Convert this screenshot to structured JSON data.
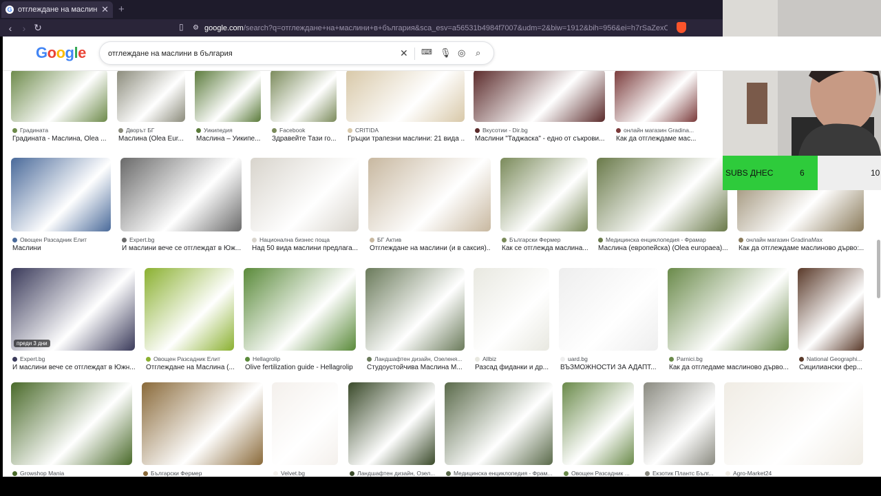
{
  "browser": {
    "tab_title": "отглеждане на маслини в българ...",
    "url_domain": "google.com",
    "url_rest": "/search?q=отглеждане+на+маслини+в+българия&sca_esv=a56531b4984f7007&udm=2&biw=1912&bih=956&ei=h7rSaZexOPSOxc8Pxr2_8QI&..."
  },
  "google": {
    "logo": "Google",
    "query": "отглеждане на маслини в българия"
  },
  "rows": [
    [
      {
        "source": "Градината",
        "title": "Градината - Маслина, Olea ...",
        "color": "#6d8a4a"
      },
      {
        "source": "Дворът БГ",
        "title": "Маслина (Olea Eur...",
        "color": "#8a8a7a"
      },
      {
        "source": "Уикипедия",
        "title": "Маслина – Уикипе...",
        "color": "#5a7a3a"
      },
      {
        "source": "Facebook",
        "title": "Здравейте Тази го...",
        "color": "#7a8a5a"
      },
      {
        "source": "CRITIDA",
        "title": "Гръцки трапезни маслини: 21 вида ...",
        "color": "#d8c8a8"
      },
      {
        "source": "Вкусотии - Dir.bg",
        "title": "Маслини \"Таджаска\" - едно от съкрови...",
        "color": "#5a2a2a"
      },
      {
        "source": "онлайн магазин Gradina...",
        "title": "Как да отглеждаме мас...",
        "color": "#7a3a3a"
      }
    ],
    [
      {
        "source": "Овощен Разсадник Елит",
        "title": "Маслини",
        "color": "#4a6a9a"
      },
      {
        "source": "Expert.bg",
        "title": "И маслини вече се отглеждат в Юж...",
        "color": "#6a6a6a"
      },
      {
        "source": "Национална бизнес поща",
        "title": "Над 50 вида маслини предлага...",
        "color": "#d8d4cc"
      },
      {
        "source": "БГ Актив",
        "title": "Отглеждане на маслини (и в саксия)...",
        "color": "#c8b8a0"
      },
      {
        "source": "Български Фермер",
        "title": "Как се отглежда маслина...",
        "color": "#7a8a5a"
      },
      {
        "source": "Медицинска енциклопедия - Фрамар",
        "title": "Маслина (европейска) (Olea europaea)...",
        "color": "#6a7a4a"
      },
      {
        "source": "онлайн магазин GradinaMax",
        "title": "Как да отглеждаме маслиново дърво:...",
        "color": "#8a7a5a"
      }
    ],
    [
      {
        "source": "Expert.bg",
        "title": "И маслини вече се отглеждат в Южн...",
        "color": "#3a3a5a",
        "badge": "преди 3 дни"
      },
      {
        "source": "Овощен Разсадник Елит",
        "title": "Отглеждане на Маслина (...",
        "color": "#8ab030"
      },
      {
        "source": "Hellagrolip",
        "title": "Olive fertilization guide - Hellagrolip",
        "color": "#5a8a3a"
      },
      {
        "source": "Ландшафтен дизайн, Озеленя...",
        "title": "Студоустойчива Маслина М...",
        "color": "#6a7a5a"
      },
      {
        "source": "Allbiz",
        "title": "Разсад фиданки и др...",
        "color": "#e8e8e0"
      },
      {
        "source": "uard.bg",
        "title": "ВЪЗМОЖНОСТИ ЗА АДАПТ...",
        "color": "#eeeeee"
      },
      {
        "source": "Parnici.bg",
        "title": "Как да отгледаме маслиново дърво...",
        "color": "#6a8a4a"
      },
      {
        "source": "National Geographi...",
        "title": "Сицилиански фер...",
        "color": "#5a3a2a"
      }
    ],
    [
      {
        "source": "Growshop Mania",
        "title": "",
        "color": "#4a6a2a"
      },
      {
        "source": "Български Фермер",
        "title": "",
        "color": "#8a6a3a"
      },
      {
        "source": "Velvet.bg",
        "title": "",
        "color": "#f4f0ec"
      },
      {
        "source": "Ландшафтен дизайн, Озел...",
        "title": "",
        "color": "#3a4a2a"
      },
      {
        "source": "Медицинска енциклопедия - Фрам...",
        "title": "",
        "color": "#5a6a4a"
      },
      {
        "source": "Овощен Разсадник ...",
        "title": "",
        "color": "#6a8a4a"
      },
      {
        "source": "Екзотик Плантс Бълг...",
        "title": "",
        "color": "#8a8a80"
      },
      {
        "source": "Agro-Market24",
        "title": "",
        "color": "#f0ece4"
      }
    ]
  ],
  "overlay": {
    "subs_label": "SUBS ДНЕС",
    "subs_today": "6",
    "subs_goal": "10"
  },
  "colors": {
    "page_bg": "#ffffff",
    "tab_bg": "#1e1b2b",
    "subs_green": "#2ecb3b"
  }
}
